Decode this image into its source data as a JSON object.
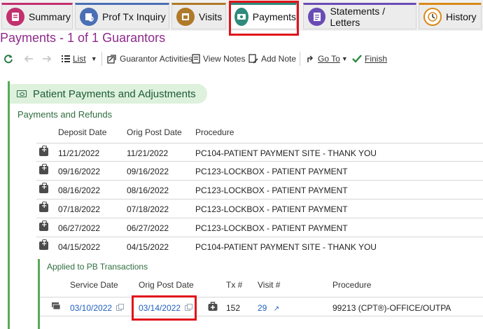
{
  "tabs": [
    {
      "label": "Summary",
      "icon": "summary-icon",
      "accent": "#c2306e"
    },
    {
      "label": "Prof Tx Inquiry",
      "icon": "prof-tx-inquiry-icon",
      "accent": "#4a6fb5"
    },
    {
      "label": "Visits",
      "icon": "visits-icon",
      "accent": "#b07a2a"
    },
    {
      "label": "Payments",
      "icon": "payments-icon",
      "accent": "#2f8a7c"
    },
    {
      "label": "Statements / Letters",
      "icon": "statements-icon",
      "accent": "#6a4bb5"
    },
    {
      "label": "History",
      "icon": "history-icon",
      "accent": "#d98a1a"
    }
  ],
  "page": {
    "title": "Payments - 1 of 1 Guarantors"
  },
  "toolbar": {
    "list": "List",
    "guarantor_activities": "Guarantor Activities",
    "view_notes": "View Notes",
    "add_note": "Add Note",
    "go_to": "Go To",
    "finish": "Finish"
  },
  "section": {
    "title": "Patient Payments and Adjustments",
    "subtitle": "Payments and Refunds",
    "columns": {
      "deposit_date": "Deposit Date",
      "orig_post_date": "Orig Post Date",
      "procedure": "Procedure"
    },
    "rows": [
      {
        "deposit_date": "11/21/2022",
        "orig_post_date": "11/21/2022",
        "procedure": "PC104-PATIENT PAYMENT SITE - THANK YOU"
      },
      {
        "deposit_date": "09/16/2022",
        "orig_post_date": "09/16/2022",
        "procedure": "PC123-LOCKBOX - PATIENT PAYMENT"
      },
      {
        "deposit_date": "08/16/2022",
        "orig_post_date": "08/16/2022",
        "procedure": "PC123-LOCKBOX - PATIENT PAYMENT"
      },
      {
        "deposit_date": "07/18/2022",
        "orig_post_date": "07/18/2022",
        "procedure": "PC123-LOCKBOX - PATIENT PAYMENT"
      },
      {
        "deposit_date": "06/27/2022",
        "orig_post_date": "06/27/2022",
        "procedure": "PC123-LOCKBOX - PATIENT PAYMENT"
      },
      {
        "deposit_date": "04/15/2022",
        "orig_post_date": "04/15/2022",
        "procedure": "PC104-PATIENT PAYMENT SITE - THANK YOU"
      }
    ]
  },
  "applied": {
    "title": "Applied to PB Transactions",
    "columns": {
      "service_date": "Service Date",
      "orig_post_date": "Orig Post Date",
      "tx": "Tx #",
      "visit": "Visit #",
      "procedure": "Procedure"
    },
    "row": {
      "service_date": "03/10/2022",
      "orig_post_date": "03/14/2022",
      "tx": "152",
      "visit": "29",
      "procedure": "99213 (CPT®)-OFFICE/OUTPA"
    }
  },
  "colors": {
    "accent_purple": "#8e2a8b",
    "section_green": "#59a95a",
    "highlight_red": "#e0131b",
    "link_blue": "#1f5fbd"
  }
}
